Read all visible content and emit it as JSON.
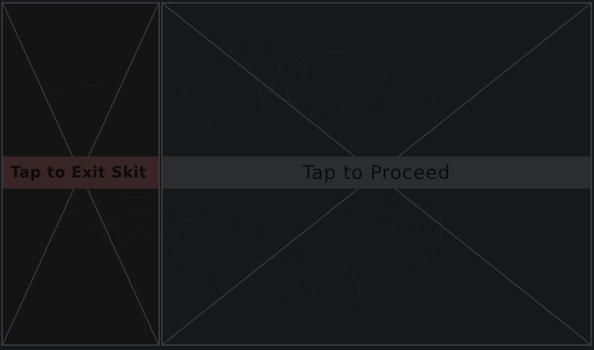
{
  "overlay": {
    "exit_label": "Tap to Exit Skit",
    "proceed_label": "Tap to Proceed"
  },
  "colors": {
    "background": "#17181a",
    "zone_border": "#3a3b3f",
    "exit_band": "#3a2526",
    "proceed_band": "#2c2d30",
    "label_text": "#0c0c0d"
  }
}
